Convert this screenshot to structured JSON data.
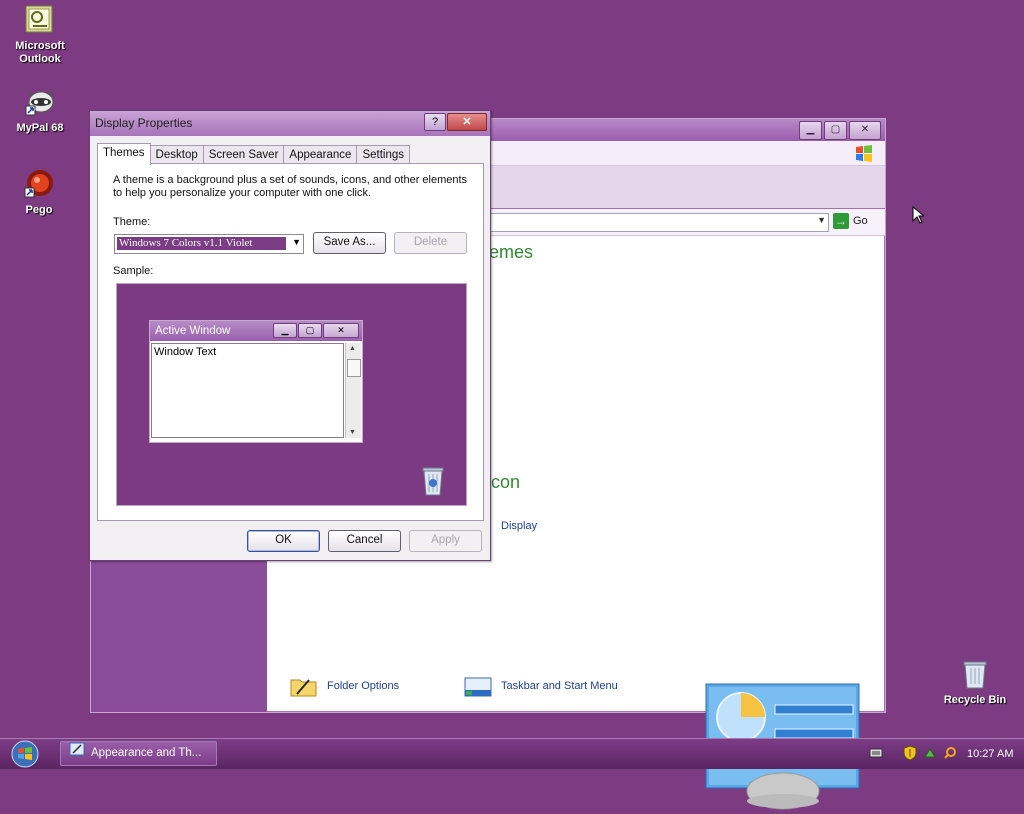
{
  "desktop": {
    "icons": [
      {
        "label": "Microsoft Outlook",
        "icon": "outlook-icon"
      },
      {
        "label": "MyPal 68",
        "icon": "raccoon-icon"
      },
      {
        "label": "Pego",
        "icon": "pego-icon"
      },
      {
        "label": "Recycle Bin",
        "icon": "recycle-bin-icon"
      }
    ]
  },
  "control_panel": {
    "heading_themes_fragment": "emes",
    "heading_icon_fragment": "con",
    "go_label": "Go",
    "links": {
      "display": "Display",
      "folder_options": "Folder Options",
      "taskbar_start_menu": "Taskbar and Start Menu"
    }
  },
  "dialog": {
    "title": "Display Properties",
    "help_glyph": "?",
    "close_glyph": "✕",
    "tabs": [
      "Themes",
      "Desktop",
      "Screen Saver",
      "Appearance",
      "Settings"
    ],
    "active_tab": "Themes",
    "description": "A theme is a background plus a set of sounds, icons, and other elements to help you personalize your computer with one click.",
    "theme_label": "Theme:",
    "theme_value": "Windows 7 Colors v1.1 Violet",
    "save_as_label": "Save As...",
    "delete_label": "Delete",
    "sample_label": "Sample:",
    "sample_window": {
      "title": "Active Window",
      "body_text": "Window Text"
    },
    "ok_label": "OK",
    "cancel_label": "Cancel",
    "apply_label": "Apply"
  },
  "taskbar": {
    "task_label": "Appearance and Th...",
    "clock": "10:27 AM"
  },
  "colors": {
    "desktop": "#7d3c82",
    "accent": "#a774b9",
    "link": "#1f3f8f",
    "heading": "#2f8a2f"
  }
}
